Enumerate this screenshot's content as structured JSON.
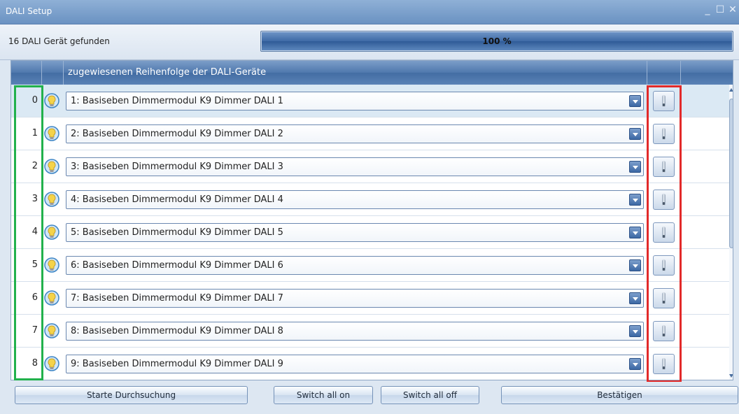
{
  "window": {
    "title": "DALI Setup",
    "controls": [
      "_",
      "☐",
      "✕"
    ]
  },
  "status": {
    "found_text": "16 DALI Gerät gefunden",
    "progress_label": "100 %",
    "progress_fraction": 1.0
  },
  "grid": {
    "header": {
      "col_device": "zugewiesenen Reihenfolge der DALI-Geräte"
    },
    "rows": [
      {
        "index": "0",
        "device": "1: Basiseben Dimmermodul K9 Dimmer DALI 1"
      },
      {
        "index": "1",
        "device": "2: Basiseben Dimmermodul K9 Dimmer DALI 2"
      },
      {
        "index": "2",
        "device": "3: Basiseben Dimmermodul K9 Dimmer DALI 3"
      },
      {
        "index": "3",
        "device": "4: Basiseben Dimmermodul K9 Dimmer DALI 4"
      },
      {
        "index": "4",
        "device": "5: Basiseben Dimmermodul K9 Dimmer DALI 5"
      },
      {
        "index": "5",
        "device": "6: Basiseben Dimmermodul K9 Dimmer DALI 6"
      },
      {
        "index": "6",
        "device": "7: Basiseben Dimmermodul K9 Dimmer DALI 7"
      },
      {
        "index": "7",
        "device": "8: Basiseben Dimmermodul K9 Dimmer DALI 8"
      },
      {
        "index": "8",
        "device": "9: Basiseben Dimmermodul K9 Dimmer DALI 9"
      }
    ]
  },
  "footer": {
    "start_search": "Starte Durchsuchung",
    "switch_all_on": "Switch all on",
    "switch_all_off": "Switch all off",
    "confirm": "Bestätigen"
  },
  "colors": {
    "highlight_index": "#22b14c",
    "highlight_switch": "#e22a2a",
    "header": "#4f78ad"
  },
  "icons": {
    "row_icon": "lightbulb-icon",
    "row_toggle": "switch-toggle-icon"
  }
}
